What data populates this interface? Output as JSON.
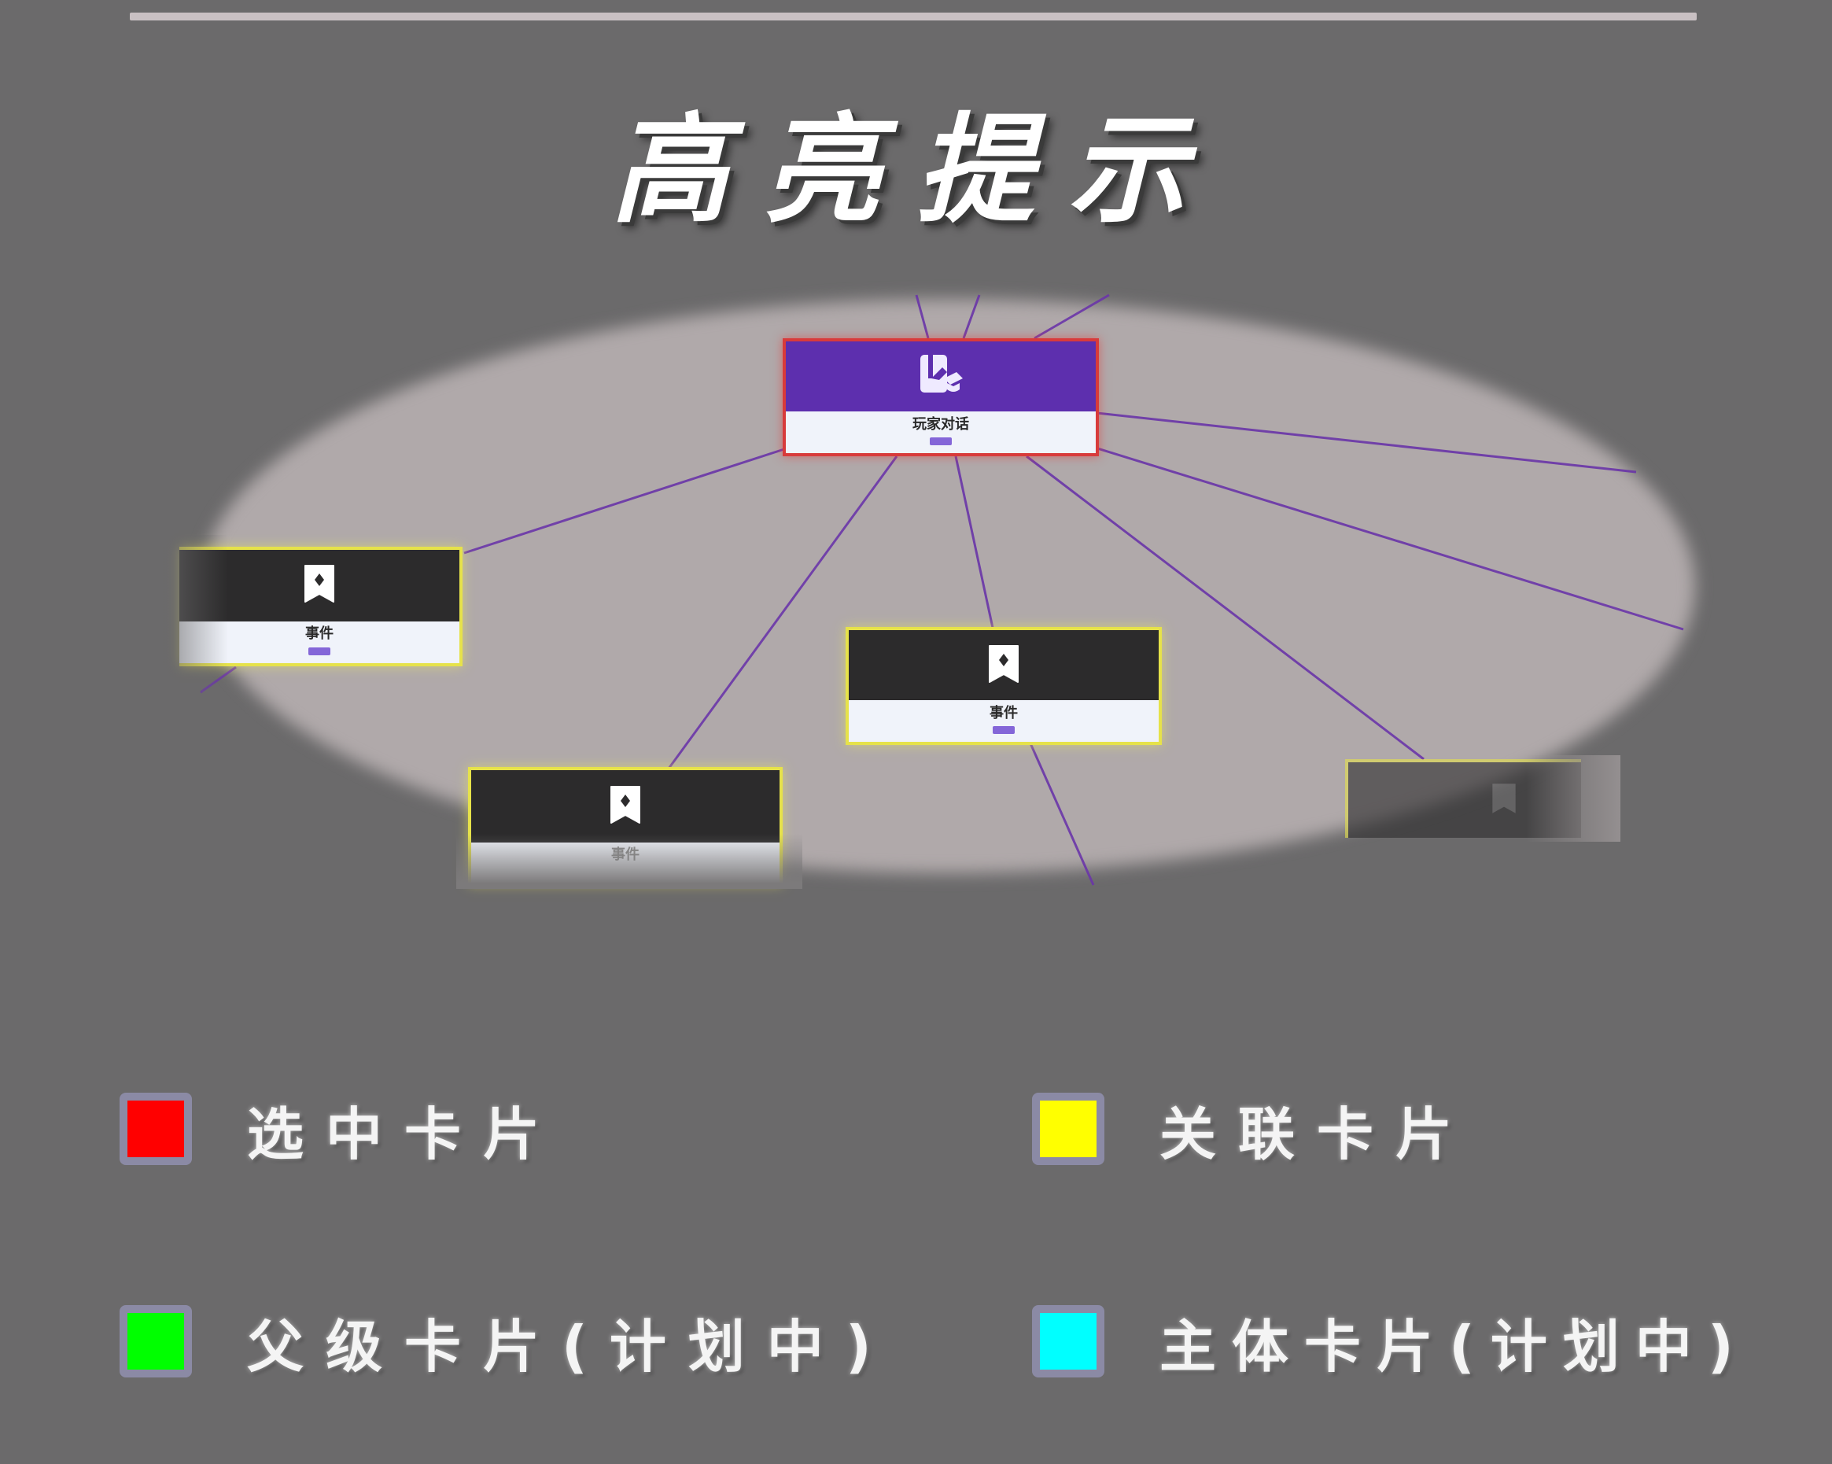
{
  "title": "高亮提示",
  "colors": {
    "selected": "#ff0000",
    "related": "#ffff00",
    "parent": "#00ff00",
    "subject": "#00ffff",
    "edge": "#6a35a8",
    "card_primary": "#5d2fae",
    "card_dark": "#2c2b2c"
  },
  "graph": {
    "main_card": {
      "name": "玩家对话",
      "icon": "dialogue-badge-icon"
    },
    "cards": [
      {
        "name": "事件",
        "icon": "bookmark-icon"
      },
      {
        "name": "事件",
        "icon": "bookmark-icon"
      },
      {
        "name": "事件",
        "icon": "bookmark-icon"
      }
    ]
  },
  "legend": [
    {
      "label": "选中卡片",
      "color": "#ff0000"
    },
    {
      "label": "关联卡片",
      "color": "#ffff00"
    },
    {
      "label": "父级卡片(计划中)",
      "color": "#00ff00"
    },
    {
      "label": "主体卡片(计划中)",
      "color": "#00ffff"
    }
  ]
}
